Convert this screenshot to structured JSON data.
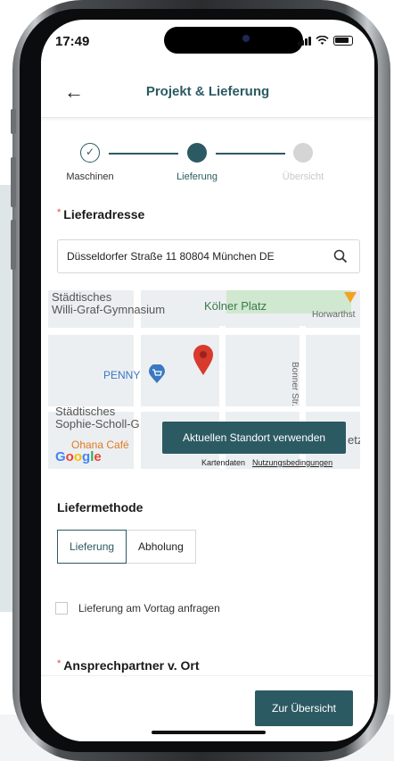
{
  "status_bar": {
    "time": "17:49"
  },
  "header": {
    "title": "Projekt & Lieferung"
  },
  "stepper": {
    "steps": [
      {
        "label": "Maschinen",
        "state": "done"
      },
      {
        "label": "Lieferung",
        "state": "active"
      },
      {
        "label": "Übersicht",
        "state": "pending"
      }
    ]
  },
  "address": {
    "label": "Lieferadresse",
    "required_marker": "*",
    "value": "Düsseldorfer Straße  11 80804 München DE"
  },
  "map": {
    "labels": {
      "school1_line1": "Städtisches",
      "school1_line2": "Willi-Graf-Gymnasium",
      "koelner_platz": "Kölner Platz",
      "horwarth": "Horwarthst",
      "penny": "PENNY",
      "school2_line1": "Städtisches",
      "school2_line2": "Sophie-Scholl-G",
      "cafe": "Ohana Café",
      "bonner_str": "Bonner Str.",
      "etz": "etz",
      "google": "Google"
    },
    "footer_data": "Kartendaten",
    "footer_terms": "Nutzungsbedingungen",
    "locate_button": "Aktuellen Standort verwenden"
  },
  "delivery_method": {
    "label": "Liefermethode",
    "options": [
      "Lieferung",
      "Abholung"
    ],
    "selected": "Lieferung"
  },
  "prior_day": {
    "label": "Lieferung am Vortag anfragen",
    "checked": false
  },
  "contact": {
    "label": "Ansprechpartner v. Ort",
    "required_marker": "*"
  },
  "footer": {
    "cta_label": "Zur Übersicht"
  },
  "colors": {
    "primary": "#2c5a63",
    "required": "#e04a3a",
    "map_bg": "#eceff1"
  }
}
